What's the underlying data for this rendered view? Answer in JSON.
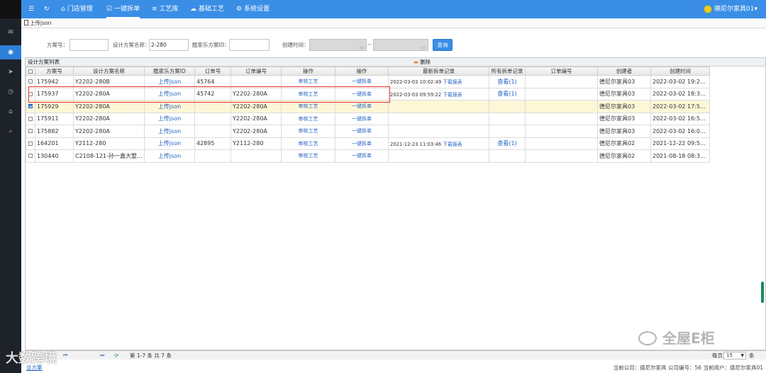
{
  "nav": {
    "items": [
      {
        "icon": "menu-icon",
        "glyph": "☰",
        "label": ""
      },
      {
        "icon": "refresh-icon",
        "glyph": "↻",
        "label": ""
      },
      {
        "icon": "home-icon",
        "glyph": "⌂",
        "label": "门店管理"
      },
      {
        "icon": "check-icon",
        "glyph": "☑",
        "label": "一键拆单"
      },
      {
        "icon": "list-icon",
        "glyph": "≡",
        "label": "工艺库"
      },
      {
        "icon": "cloud-icon",
        "glyph": "☁",
        "label": "基础工艺"
      },
      {
        "icon": "gear-icon",
        "glyph": "⚙",
        "label": "系统设置"
      }
    ],
    "user": "德尼尔家具01",
    "user_caret": "▾"
  },
  "tab": {
    "label": "上传json"
  },
  "form": {
    "plan_no_label": "方案号：",
    "plan_no_value": "",
    "plan_name_label": "设计方案名称：",
    "plan_name_value": "2-280",
    "kujiale_label": "酷家乐方案ID：",
    "kujiale_value": "",
    "created_label": "创建时间：",
    "date_sep": "--",
    "query_label": "查询"
  },
  "grid": {
    "title": "设计方案列表",
    "delete_label": "删除",
    "columns": [
      "",
      "方案号",
      "设计方案名称",
      "酷家乐方案ID",
      "订单号",
      "订单编号",
      "操作",
      "操作",
      "最新拆单记录",
      "所有拆单记录",
      "订单编号",
      "创建者",
      "创建时间"
    ],
    "rows": [
      {
        "checked": false,
        "plan_no": "175942",
        "name": "Y2202-280B",
        "upload": "上传json",
        "order_no": "45764",
        "order_code": "",
        "op1": "审核工艺",
        "op2": "一键拆单",
        "latest": "",
        "report": "",
        "all": "",
        "order_code2": "",
        "creator": "德尼尔家具03",
        "created": "2022-03-02 19:26..."
      },
      {
        "checked": false,
        "plan_no": "175937",
        "name": "Y2202-280A",
        "upload": "上传json",
        "order_no": "45742",
        "order_code": "Y2202-280A",
        "op1": "审核工艺",
        "op2": "一键拆单",
        "latest": "2022-03-03 09:59:22",
        "report": "下载报表",
        "all": "查看(1)",
        "order_code2": "",
        "creator": "德尼尔家具03",
        "created": "2022-03-02 18:31..."
      },
      {
        "checked": true,
        "plan_no": "175929",
        "name": "Y2202-280A",
        "upload": "上传json",
        "order_no": "",
        "order_code": "Y2202-280A",
        "op1": "审核工艺",
        "op2": "一键拆单",
        "latest": "",
        "report": "",
        "all": "",
        "order_code2": "",
        "creator": "德尼尔家具03",
        "created": "2022-03-02 17:50..."
      },
      {
        "checked": false,
        "plan_no": "175911",
        "name": "Y2202-280A",
        "upload": "上传json",
        "order_no": "",
        "order_code": "Y2202-280A",
        "op1": "审核工艺",
        "op2": "一键拆单",
        "latest": "",
        "report": "",
        "all": "",
        "order_code2": "",
        "creator": "德尼尔家具03",
        "created": "2022-03-02 16:51..."
      },
      {
        "checked": false,
        "plan_no": "175882",
        "name": "Y2202-280A",
        "upload": "上传json",
        "order_no": "",
        "order_code": "Y2202-280A",
        "op1": "审核工艺",
        "op2": "一键拆单",
        "latest": "",
        "report": "",
        "all": "",
        "order_code2": "",
        "creator": "德尼尔家具03",
        "created": "2022-03-02 16:06..."
      },
      {
        "checked": false,
        "plan_no": "164201",
        "name": "Y2112-280",
        "upload": "上传json",
        "order_no": "42895",
        "order_code": "Y2112-280",
        "op1": "审核工艺",
        "op2": "一键拆单",
        "latest": "2021-12-23 11:03:46",
        "report": "下载报表",
        "all": "查看(1)",
        "order_code2": "",
        "creator": "德尼尔家具02",
        "created": "2021-12-22 09:58..."
      },
      {
        "checked": false,
        "plan_no": "130440",
        "name": "C2108-121-孙一鑫大墅...",
        "upload": "上传json",
        "order_no": "",
        "order_code": "",
        "op1": "审核工艺",
        "op2": "一键拆单",
        "latest": "",
        "report": "",
        "all": "",
        "order_code2": "",
        "creator": "德尼尔家具02",
        "created": "2021-08-18 08:32..."
      }
    ],
    "header_row_latest": "2022-03-03 10:02:49"
  },
  "row0_extra": {
    "latest": "2022-03-03 10:02:49",
    "report": "下载报表",
    "all": "查看(1)"
  },
  "pager": {
    "refresh_glyph": "⟳",
    "summary": "第 1-7 条  共 7 条",
    "page_size_label": "每页",
    "page_size": "15",
    "unit": "条",
    "pg_fragment": "1/1"
  },
  "footer": {
    "link": "总方案",
    "info": "当前公司：德尼尔家具   公司编号：56   当前用户：德尼尔家具01"
  },
  "watermarks": {
    "w1": "全屋E柜",
    "w2": "大数跨境"
  },
  "colors": {
    "topbar": "#3a8ee6",
    "sidebar": "#1e2229",
    "highlight": "#e53232",
    "link": "#2363c4"
  }
}
